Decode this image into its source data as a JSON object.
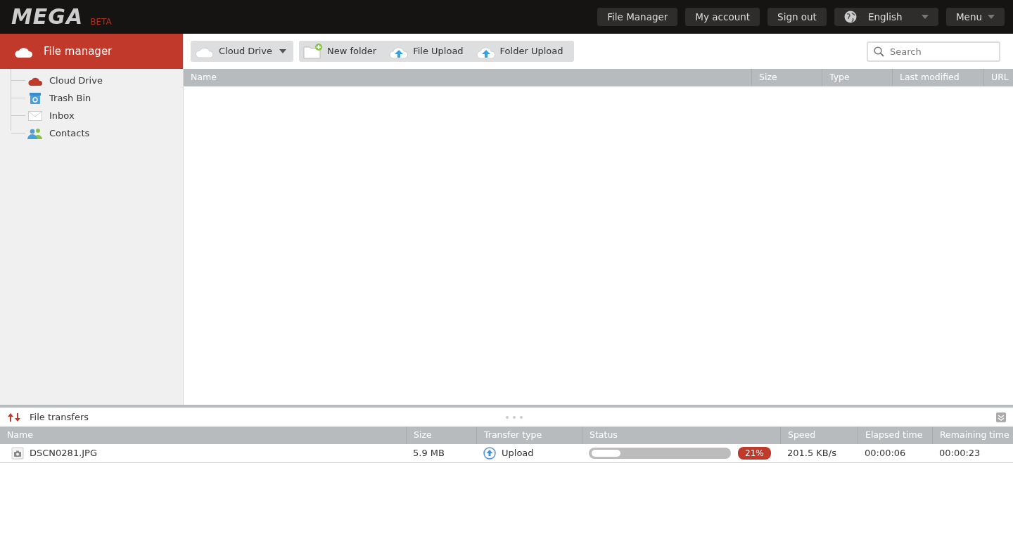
{
  "header": {
    "logo": "MEGA",
    "badge": "BETA",
    "nav": [
      "File Manager",
      "My account",
      "Sign out"
    ],
    "language": "English",
    "menu": "Menu"
  },
  "sidebar": {
    "title": "File manager",
    "items": [
      {
        "label": "Cloud Drive",
        "kind": "cloud"
      },
      {
        "label": "Trash Bin",
        "kind": "trash"
      },
      {
        "label": "Inbox",
        "kind": "inbox"
      },
      {
        "label": "Contacts",
        "kind": "contacts"
      }
    ]
  },
  "toolbar": {
    "location": "Cloud Drive",
    "actions": [
      {
        "label": "New folder",
        "kind": "folder"
      },
      {
        "label": "File Upload",
        "kind": "upload"
      },
      {
        "label": "Folder Upload",
        "kind": "upload"
      }
    ],
    "search": {
      "placeholder": "Search"
    }
  },
  "file_table": {
    "columns": [
      "Name",
      "Size",
      "Type",
      "Last modified",
      "URL"
    ]
  },
  "transfers": {
    "title": "File transfers",
    "columns": [
      "Name",
      "Size",
      "Transfer type",
      "Status",
      "Speed",
      "Elapsed time",
      "Remaining time"
    ],
    "rows": [
      {
        "name": "DSCN0281.JPG",
        "size": "5.9 MB",
        "transfer_type": "Upload",
        "level": 0.21,
        "percent": "21%",
        "speed": "201.5 KB/s",
        "elapsed": "00:00:06",
        "remaining": "00:00:23"
      }
    ]
  }
}
